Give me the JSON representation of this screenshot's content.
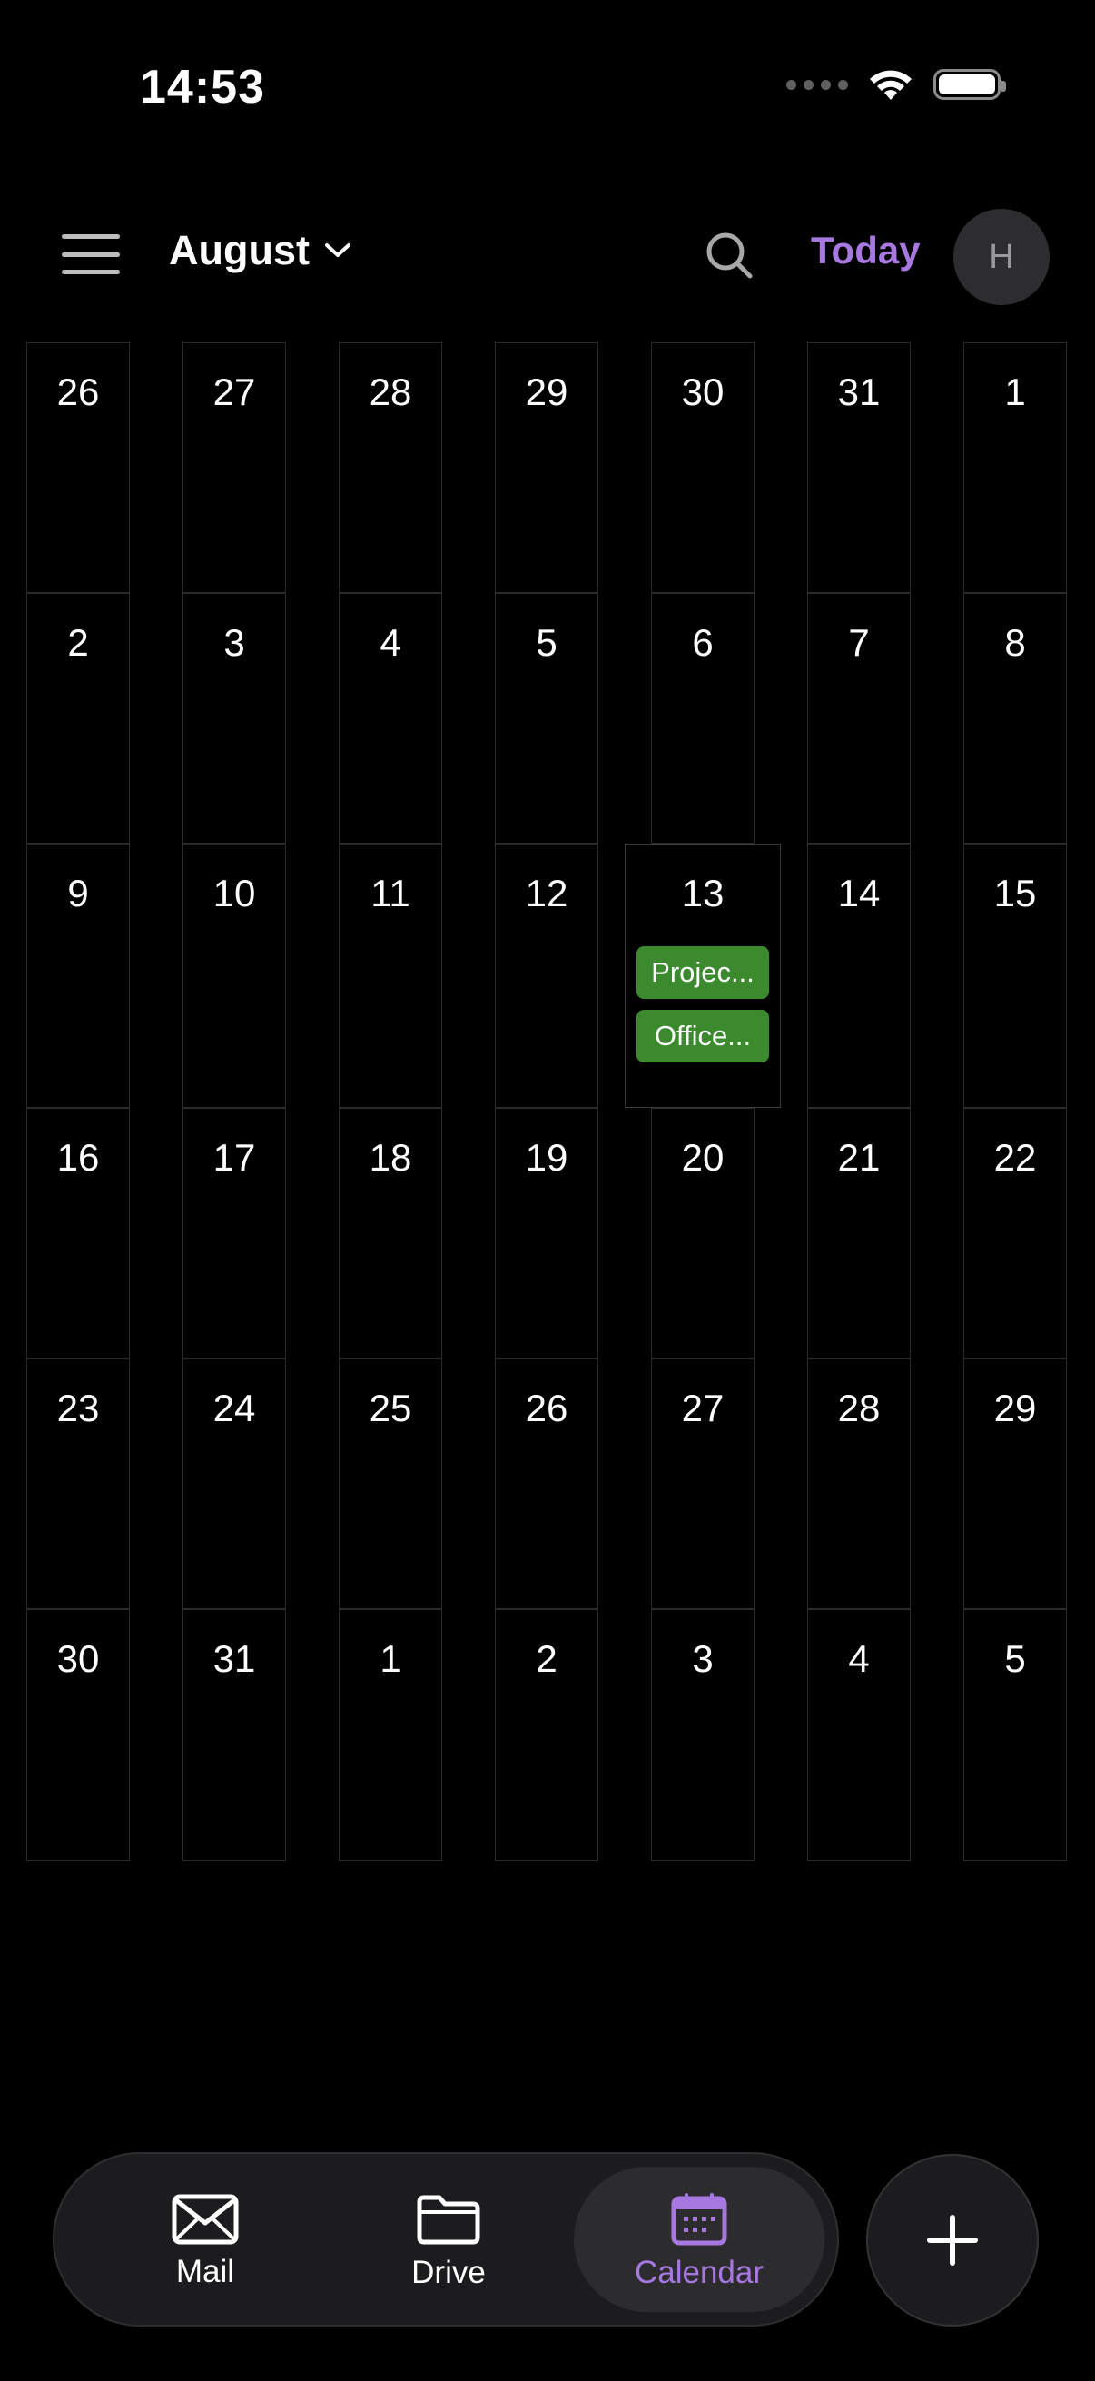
{
  "status_bar": {
    "time": "14:53"
  },
  "header": {
    "menu_icon": "hamburger-menu-icon",
    "month": "August",
    "search_icon": "search-icon",
    "today_label": "Today",
    "avatar_initial": "H"
  },
  "calendar": {
    "weeks": [
      [
        "26",
        "27",
        "28",
        "29",
        "30",
        "31",
        "1"
      ],
      [
        "2",
        "3",
        "4",
        "5",
        "6",
        "7",
        "8"
      ],
      [
        "9",
        "10",
        "11",
        "12",
        "13",
        "14",
        "15"
      ],
      [
        "16",
        "17",
        "18",
        "19",
        "20",
        "21",
        "22"
      ],
      [
        "23",
        "24",
        "25",
        "26",
        "27",
        "28",
        "29"
      ],
      [
        "30",
        "31",
        "1",
        "2",
        "3",
        "4",
        "5"
      ]
    ],
    "selected": {
      "week": 2,
      "day": 4
    },
    "events": [
      {
        "week": 2,
        "day": 4,
        "title": "Projec..."
      },
      {
        "week": 2,
        "day": 4,
        "title": "Office..."
      }
    ]
  },
  "tab_bar": {
    "tabs": [
      {
        "label": "Mail",
        "icon": "mail-icon",
        "active": false
      },
      {
        "label": "Drive",
        "icon": "folder-icon",
        "active": false
      },
      {
        "label": "Calendar",
        "icon": "calendar-icon",
        "active": true
      }
    ],
    "fab_icon": "plus-icon"
  },
  "colors": {
    "background": "#000000",
    "accent": "#a678e0",
    "event": "#3b8a2e",
    "cell_border": "#2a2a2a",
    "surface": "#1c1c1e"
  }
}
